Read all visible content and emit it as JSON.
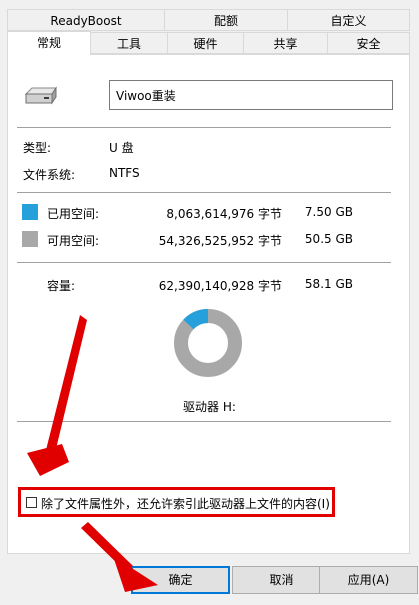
{
  "tabs_row1": [
    "ReadyBoost",
    "配额",
    "自定义"
  ],
  "tabs_row2": [
    "常规",
    "工具",
    "硬件",
    "共享",
    "安全"
  ],
  "drive_name": "Viwoo重装",
  "type": {
    "label": "类型:",
    "value": "U 盘"
  },
  "filesystem": {
    "label": "文件系统:",
    "value": "NTFS"
  },
  "used": {
    "label": "已用空间:",
    "bytes": "8,063,614,976 字节",
    "size": "7.50 GB",
    "color": "#26a0da"
  },
  "free": {
    "label": "可用空间:",
    "bytes": "54,326,525,952 字节",
    "size": "50.5 GB",
    "color": "#a8a8a8"
  },
  "capacity": {
    "label": "容量:",
    "bytes": "62,390,140,928 字节",
    "size": "58.1 GB"
  },
  "used_fraction": 0.1292,
  "drive_label": "驱动器 H:",
  "index_checkbox": {
    "label": "除了文件属性外，还允许索引此驱动器上文件的内容(I)",
    "checked": false
  },
  "buttons": {
    "ok": "确定",
    "cancel": "取消",
    "apply": "应用(A)"
  }
}
